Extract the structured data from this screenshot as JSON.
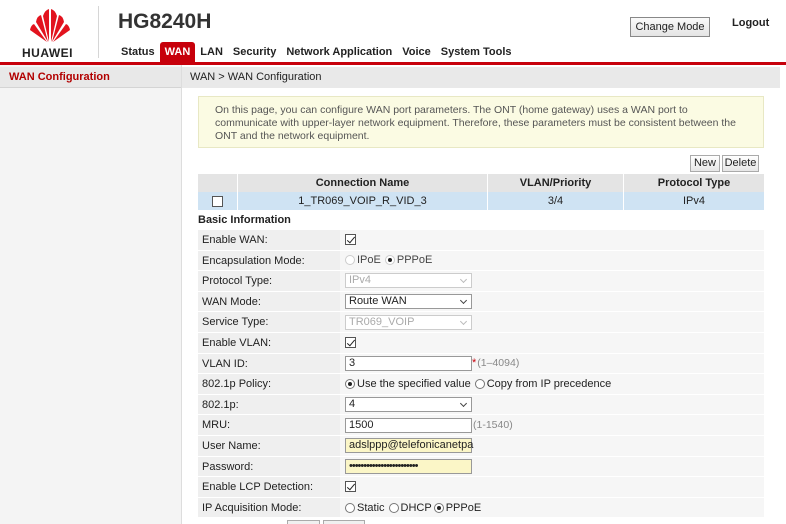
{
  "header": {
    "brand": "HUAWEI",
    "model": "HG8240H",
    "change_mode_label": "Change Mode",
    "logout_label": "Logout"
  },
  "nav": {
    "items": [
      {
        "label": "Status"
      },
      {
        "label": "WAN",
        "active": true
      },
      {
        "label": "LAN"
      },
      {
        "label": "Security"
      },
      {
        "label": "Network Application"
      },
      {
        "label": "Voice"
      },
      {
        "label": "System Tools"
      }
    ]
  },
  "sidebar": {
    "items": [
      {
        "label": "WAN Configuration",
        "active": true
      }
    ]
  },
  "breadcrumb": "WAN > WAN Configuration",
  "notice": "On this page, you can configure WAN port parameters. The ONT (home gateway) uses a WAN port to communicate with upper-layer network equipment. Therefore, these parameters must be consistent between the ONT and the network equipment.",
  "toolbar": {
    "new_label": "New",
    "delete_label": "Delete"
  },
  "connection_table": {
    "headers": [
      "Connection Name",
      "VLAN/Priority",
      "Protocol Type"
    ],
    "rows": [
      {
        "name": "1_TR069_VOIP_R_VID_3",
        "vlan_priority": "3/4",
        "protocol": "IPv4",
        "checked": false
      }
    ]
  },
  "section_title": "Basic Information",
  "form": {
    "enable_wan": {
      "label": "Enable WAN:",
      "checked": true
    },
    "encapsulation": {
      "label": "Encapsulation Mode:",
      "options": [
        "IPoE",
        "PPPoE"
      ],
      "selected": "PPPoE",
      "disabled": true
    },
    "protocol_type": {
      "label": "Protocol Type:",
      "value": "IPv4",
      "disabled": true
    },
    "wan_mode": {
      "label": "WAN Mode:",
      "value": "Route WAN"
    },
    "service_type": {
      "label": "Service Type:",
      "value": "TR069_VOIP",
      "disabled": true
    },
    "enable_vlan": {
      "label": "Enable VLAN:",
      "checked": true
    },
    "vlan_id": {
      "label": "VLAN ID:",
      "value": "3",
      "required_mark": "*",
      "hint": "(1–4094)"
    },
    "policy_8021p": {
      "label": "802.1p Policy:",
      "options": [
        "Use the specified value",
        "Copy from IP precedence"
      ],
      "selected": "Use the specified value"
    },
    "val_8021p": {
      "label": "802.1p:",
      "value": "4"
    },
    "mru": {
      "label": "MRU:",
      "value": "1500",
      "hint": "(1-1540)"
    },
    "username": {
      "label": "User Name:",
      "value": "adslppp@telefonicanetpa"
    },
    "password": {
      "label": "Password:",
      "value": "••••••••••••••••••••••••"
    },
    "enable_lcp": {
      "label": "Enable LCP Detection:",
      "checked": true
    },
    "ip_acquisition": {
      "label": "IP Acquisition Mode:",
      "options": [
        "Static",
        "DHCP",
        "PPPoE"
      ],
      "selected": "PPPoE"
    }
  },
  "colors": {
    "accent": "#c7000b",
    "selected_row": "#cfe3f3",
    "notice_bg": "#fbfbe3"
  }
}
